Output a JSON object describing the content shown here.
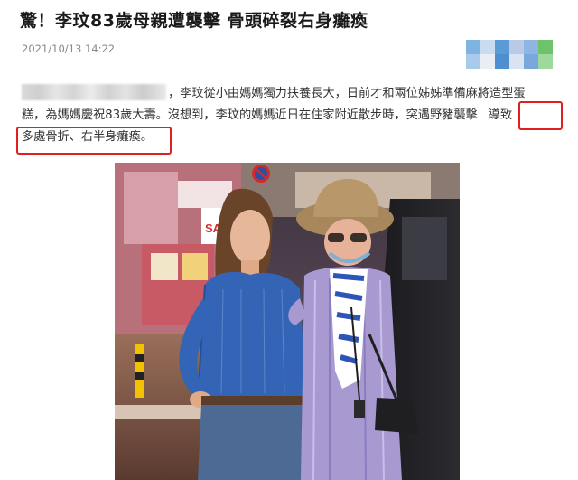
{
  "article": {
    "headline": "驚！李玟83歲母親遭襲擊 骨頭碎裂右身癱瘓",
    "timestamp": "2021/10/13 14:22",
    "paragraph": {
      "line1": "，李玟從小由媽媽獨力扶養長大，日前才和兩位姊姊準備麻將造型蛋",
      "line2": "糕，為媽媽慶祝83歲大壽。沒想到，李玟的媽媽近日在住家附近散步時，突遇野豬襲擊",
      "line2_highlight": "導致",
      "line3_highlight": "多處骨折、右半身癱瘓。"
    }
  },
  "photo": {
    "sign_text": "SALE",
    "alt": "photo-of-two-women-on-street"
  },
  "colors": {
    "highlight_border": "#e02020",
    "headline": "#1a1a1a",
    "timestamp": "#888888",
    "body_text": "#333333"
  }
}
